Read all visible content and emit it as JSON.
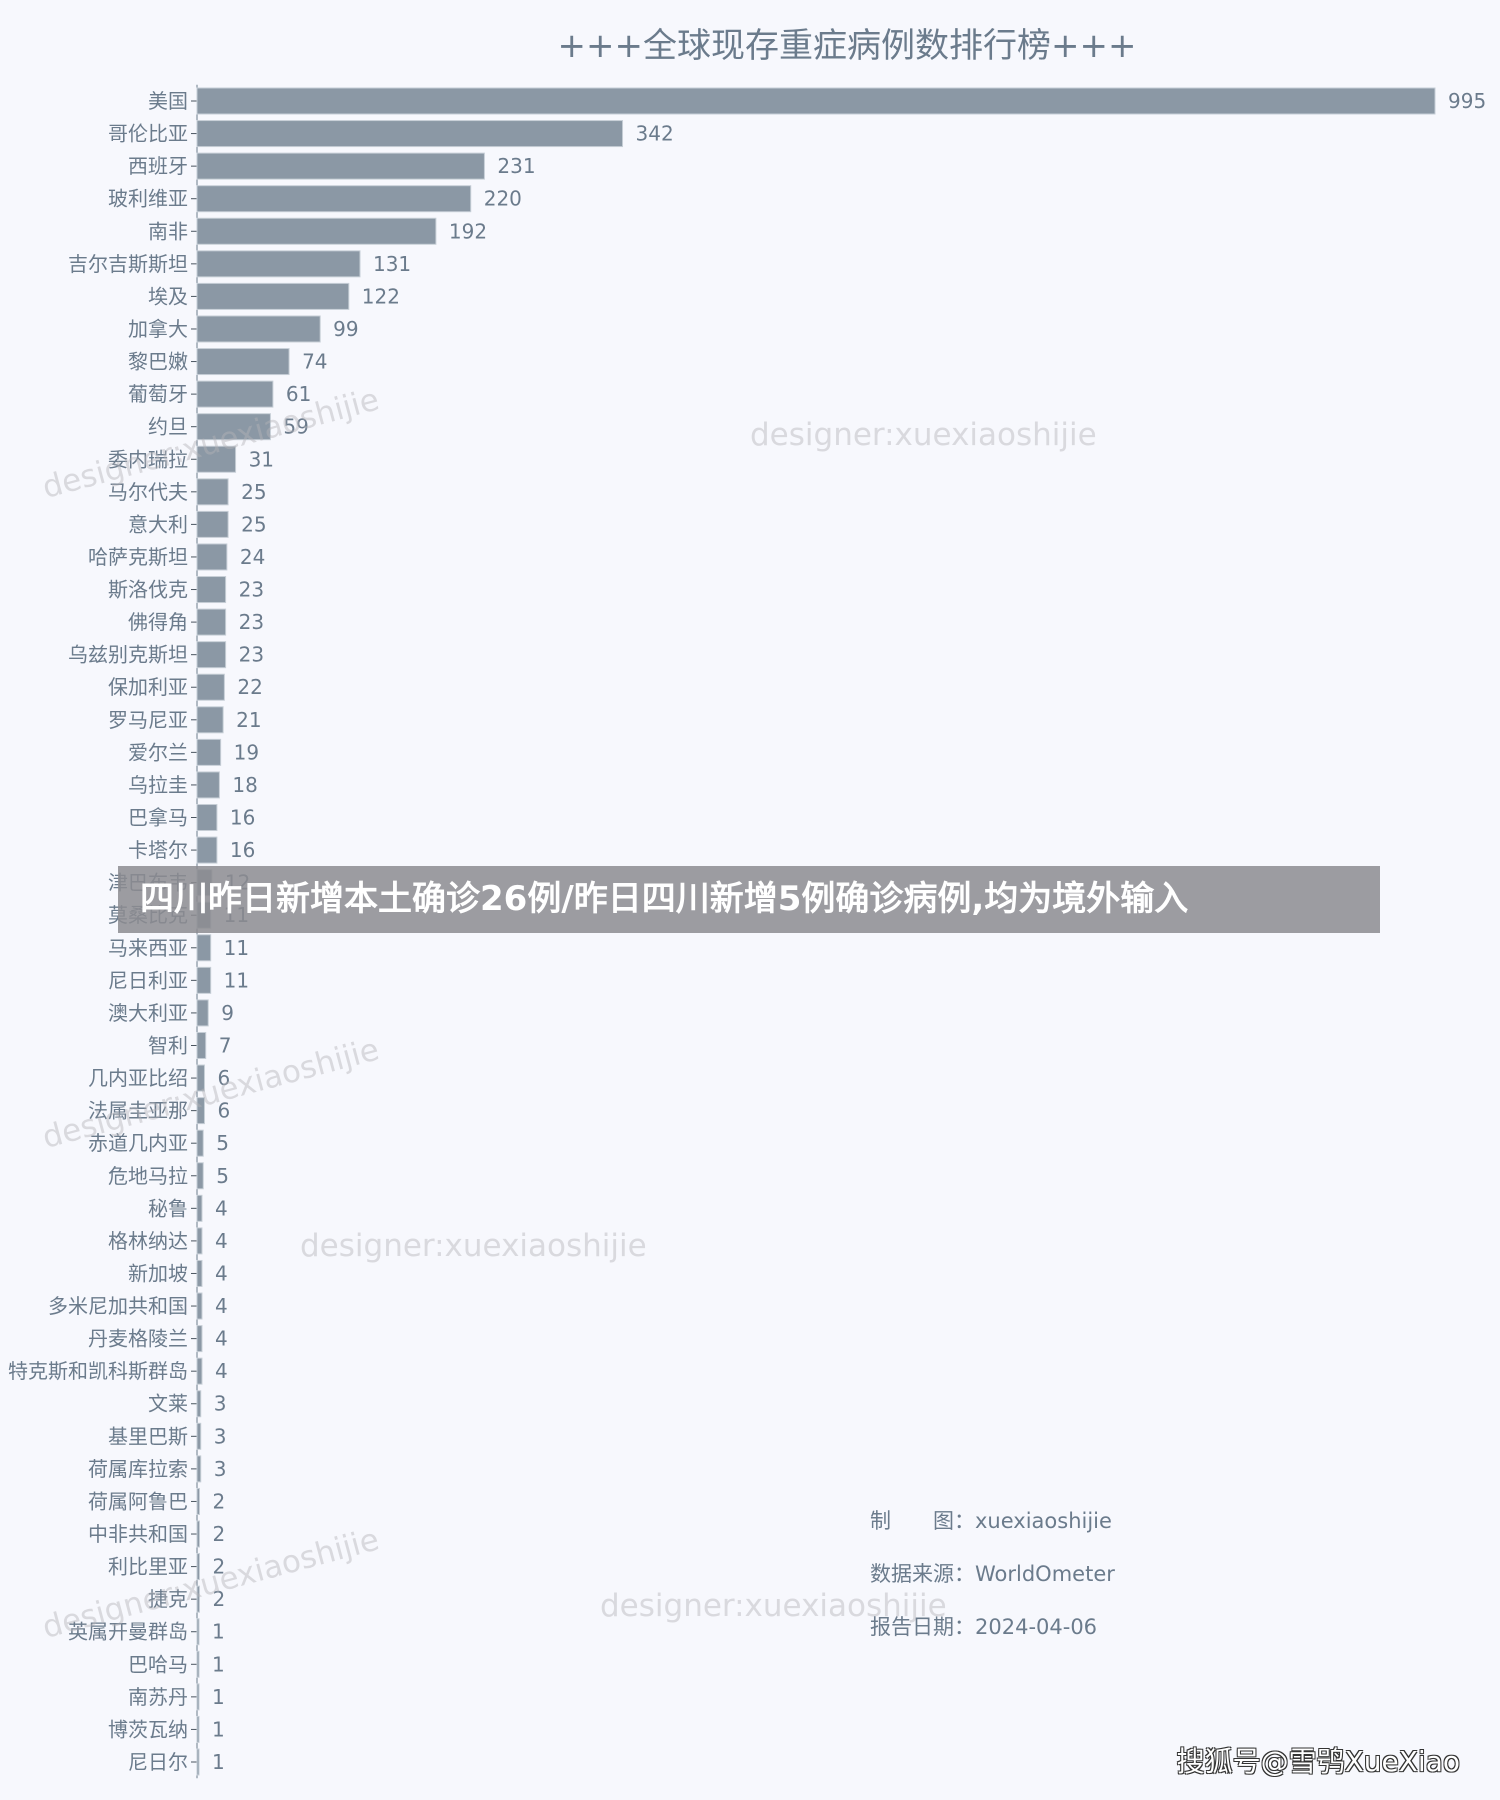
{
  "chart_data": {
    "type": "bar",
    "orientation": "horizontal",
    "title": "+++全球现存重症病例数排行榜+++",
    "xlabel": "",
    "ylabel": "",
    "xlim": [
      0,
      995
    ],
    "grid": false,
    "categories": [
      "美国",
      "哥伦比亚",
      "西班牙",
      "玻利维亚",
      "南非",
      "吉尔吉斯斯坦",
      "埃及",
      "加拿大",
      "黎巴嫩",
      "葡萄牙",
      "约旦",
      "委内瑞拉",
      "马尔代夫",
      "意大利",
      "哈萨克斯坦",
      "斯洛伐克",
      "佛得角",
      "乌兹别克斯坦",
      "保加利亚",
      "罗马尼亚",
      "爱尔兰",
      "乌拉圭",
      "巴拿马",
      "卡塔尔",
      "津巴布韦",
      "莫桑比克",
      "马来西亚",
      "尼日利亚",
      "澳大利亚",
      "智利",
      "几内亚比绍",
      "法属圭亚那",
      "赤道几内亚",
      "危地马拉",
      "秘鲁",
      "格林纳达",
      "新加坡",
      "多米尼加共和国",
      "丹麦格陵兰",
      "特克斯和凯科斯群岛",
      "文莱",
      "基里巴斯",
      "荷属库拉索",
      "荷属阿鲁巴",
      "中非共和国",
      "利比里亚",
      "捷克",
      "英属开曼群岛",
      "巴哈马",
      "南苏丹",
      "博茨瓦纳",
      "尼日尔"
    ],
    "values": [
      995,
      342,
      231,
      220,
      192,
      131,
      122,
      99,
      74,
      61,
      59,
      31,
      25,
      25,
      24,
      23,
      23,
      23,
      22,
      21,
      19,
      18,
      16,
      16,
      12,
      11,
      11,
      11,
      9,
      7,
      6,
      6,
      5,
      5,
      4,
      4,
      4,
      4,
      4,
      4,
      3,
      3,
      3,
      2,
      2,
      2,
      2,
      1,
      1,
      1,
      1,
      1
    ],
    "colors": {
      "bar": "#8b98a5",
      "text": "#6b7b8c",
      "background": "#f7f8fd"
    }
  },
  "watermark": "designer:xuexiaoshijie",
  "credits": {
    "maker_label": "制　　图：",
    "maker_value": "xuexiaoshijie",
    "source_label": "数据来源：",
    "source_value": "WorldOmeter",
    "date_label": "报告日期：",
    "date_value": "2024-04-06"
  },
  "banner": "四川昨日新增本土确诊26例/昨日四川新增5例确诊病例,均为境外输入",
  "source_mark": "搜狐号@雪鸮XueXiao"
}
